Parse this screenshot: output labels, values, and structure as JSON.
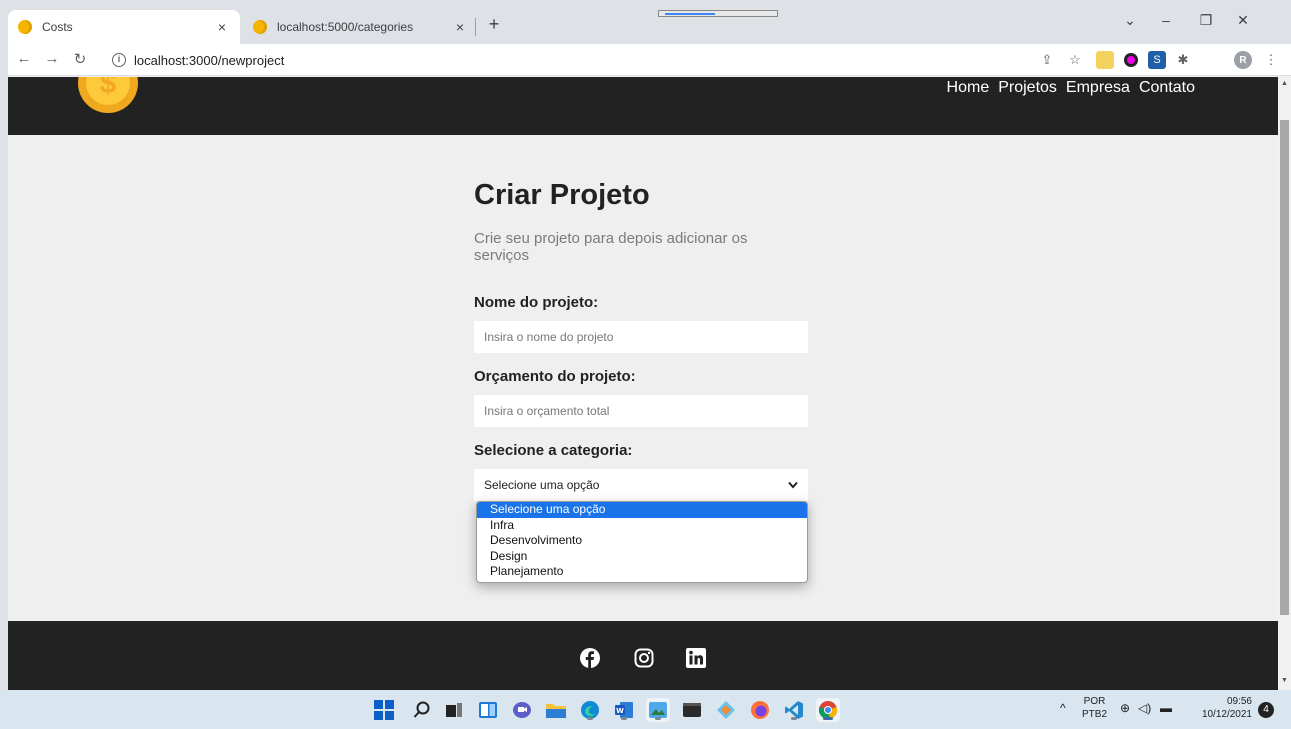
{
  "browser": {
    "tabs": [
      {
        "title": "Costs",
        "active": true
      },
      {
        "title": "localhost:5000/categories",
        "active": false
      }
    ],
    "url": "localhost:3000/newproject",
    "new_tab": "+",
    "close_glyph": "×"
  },
  "navbar": {
    "logo_symbol": "$",
    "links": [
      "Home",
      "Projetos",
      "Empresa",
      "Contato"
    ]
  },
  "form": {
    "title": "Criar Projeto",
    "subtitle": "Crie seu projeto para depois adicionar os serviços",
    "name_label": "Nome do projeto:",
    "name_placeholder": "Insira o nome do projeto",
    "budget_label": "Orçamento do projeto:",
    "budget_placeholder": "Insira o orçamento total",
    "category_label": "Selecione a categoria:",
    "category_selected": "Selecione uma opção",
    "category_options": [
      "Selecione uma opção",
      "Infra",
      "Desenvolvimento",
      "Design",
      "Planejamento"
    ]
  },
  "footer": {
    "icons": [
      "facebook-icon",
      "instagram-icon",
      "linkedin-icon"
    ]
  },
  "taskbar": {
    "lang_top": "POR",
    "lang_bottom": "PTB2",
    "time": "09:56",
    "date": "10/12/2021",
    "notifications": "4"
  },
  "colors": {
    "navbar_bg": "#222222",
    "page_bg": "#efefef",
    "accent_yellow": "#ffc93c",
    "option_highlight": "#1a73e8"
  }
}
